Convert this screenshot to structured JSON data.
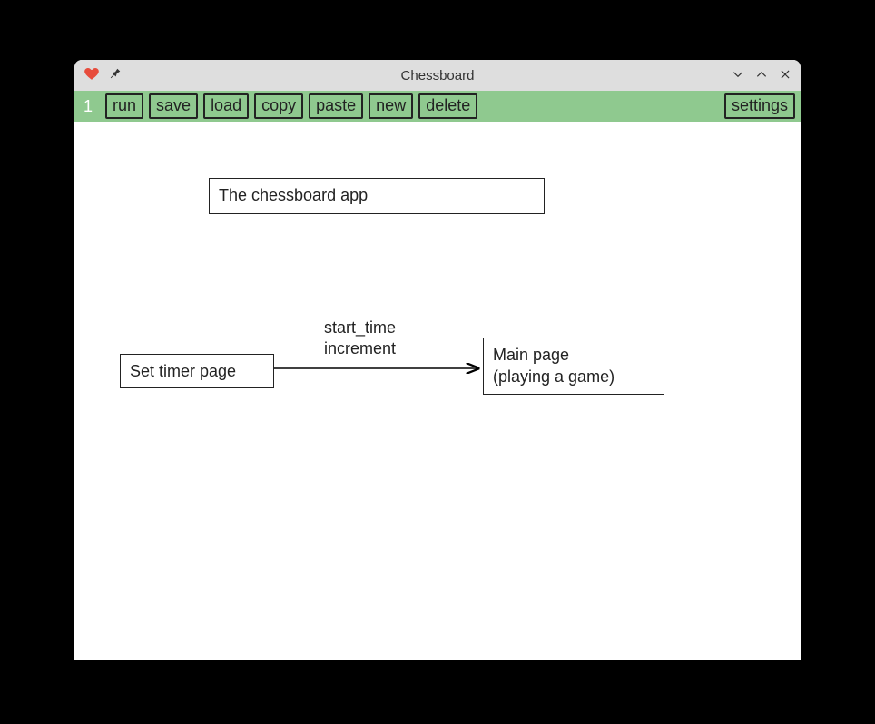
{
  "window": {
    "title": "Chessboard"
  },
  "toolbar": {
    "page_number": "1",
    "buttons": {
      "run": "run",
      "save": "save",
      "load": "load",
      "copy": "copy",
      "paste": "paste",
      "new": "new",
      "delete": "delete",
      "settings": "settings"
    }
  },
  "diagram": {
    "title_node": "The chessboard app",
    "timer_node": "Set timer page",
    "main_node": "Main page\n(playing a game)",
    "edge_label": "start_time\nincrement"
  }
}
